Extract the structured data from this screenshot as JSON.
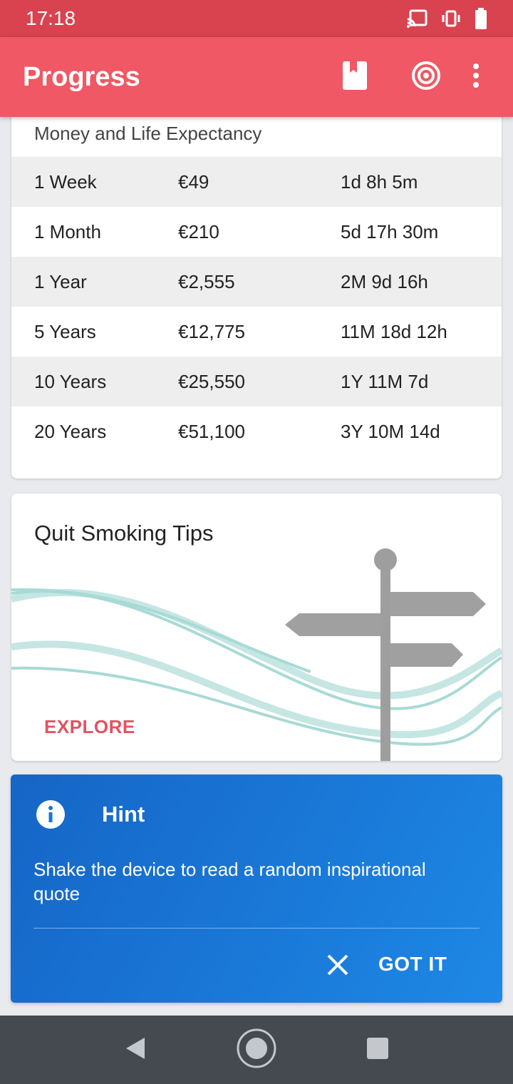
{
  "status_bar": {
    "time": "17:18",
    "icons": [
      "cast-icon",
      "vibrate-icon",
      "battery-icon"
    ]
  },
  "app_bar": {
    "title": "Progress",
    "actions": [
      "book-icon",
      "target-icon",
      "more-vert-icon"
    ],
    "color": "#ef5864"
  },
  "money_card": {
    "subtitle": "Money and Life Expectancy",
    "rows": [
      {
        "period": "1 Week",
        "money": "€49",
        "life": "1d 8h 5m"
      },
      {
        "period": "1 Month",
        "money": "€210",
        "life": "5d 17h 30m"
      },
      {
        "period": "1 Year",
        "money": "€2,555",
        "life": "2M 9d 16h"
      },
      {
        "period": "5 Years",
        "money": "€12,775",
        "life": "11M 18d 12h"
      },
      {
        "period": "10 Years",
        "money": "€25,550",
        "life": "1Y 11M 7d"
      },
      {
        "period": "20 Years",
        "money": "€51,100",
        "life": "3Y 10M 14d"
      }
    ]
  },
  "tips_card": {
    "title": "Quit Smoking Tips",
    "button": "EXPLORE",
    "illustration": "signpost-illustration"
  },
  "hint_card": {
    "title": "Hint",
    "text": "Shake the device to read a random inspirational quote",
    "button": "GOT IT",
    "icon": "info-icon"
  },
  "nav_bar": {
    "buttons": [
      "back-icon",
      "home-icon",
      "recents-icon"
    ]
  }
}
